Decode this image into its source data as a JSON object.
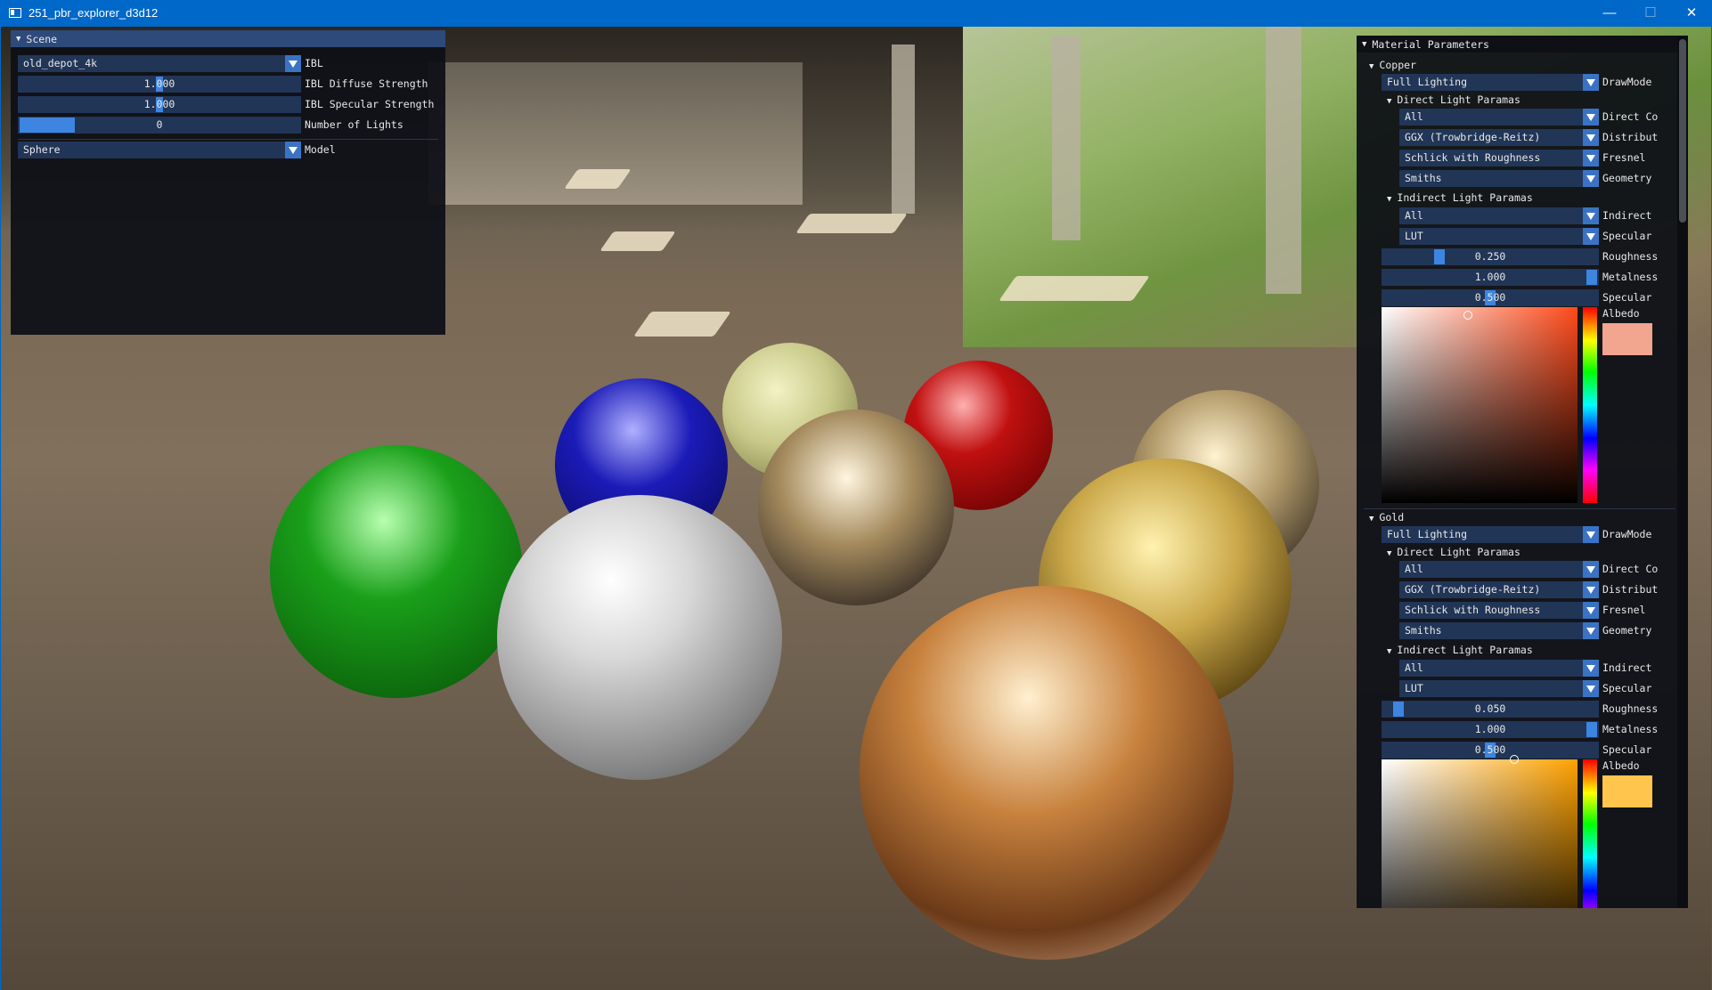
{
  "window": {
    "title": "251_pbr_explorer_d3d12",
    "minimize": "—",
    "maximize": "☐",
    "close": "✕"
  },
  "scene_panel": {
    "title": "Scene",
    "ibl": {
      "value": "old_depot_4k",
      "label": "IBL"
    },
    "diffuse": {
      "value": "1.000",
      "label": "IBL Diffuse Strength",
      "fraction": 0.5
    },
    "specular": {
      "value": "1.000",
      "label": "IBL Specular Strength",
      "fraction": 0.5
    },
    "lights": {
      "value": "0",
      "label": "Number of Lights",
      "fraction": 0.0
    },
    "model": {
      "value": "Sphere",
      "label": "Model"
    }
  },
  "material_panel": {
    "title": "Material Parameters",
    "materials": [
      {
        "name": "Copper",
        "drawmode": {
          "value": "Full Lighting",
          "label": "DrawMode"
        },
        "direct_header": "Direct Light Paramas",
        "direct": [
          {
            "value": "All",
            "label": "Direct Co"
          },
          {
            "value": "GGX (Trowbridge-Reitz)",
            "label": "Distribut"
          },
          {
            "value": "Schlick with Roughness",
            "label": "Fresnel"
          },
          {
            "value": "Smiths",
            "label": "Geometry"
          }
        ],
        "indirect_header": "Indirect Light Paramas",
        "indirect": [
          {
            "value": "All",
            "label": "Indirect"
          },
          {
            "value": "LUT",
            "label": "Specular"
          }
        ],
        "roughness": {
          "value": "0.250",
          "label": "Roughness",
          "fraction": 0.25
        },
        "metalness": {
          "value": "1.000",
          "label": "Metalness",
          "fraction": 1.0
        },
        "specular": {
          "value": "0.500",
          "label": "Specular",
          "fraction": 0.5
        },
        "albedo": {
          "label": "Albedo",
          "color": "#f2a58f",
          "hue_color": "#ff4a1a"
        }
      },
      {
        "name": "Gold",
        "drawmode": {
          "value": "Full Lighting",
          "label": "DrawMode"
        },
        "direct_header": "Direct Light Paramas",
        "direct": [
          {
            "value": "All",
            "label": "Direct Co"
          },
          {
            "value": "GGX (Trowbridge-Reitz)",
            "label": "Distribut"
          },
          {
            "value": "Schlick with Roughness",
            "label": "Fresnel"
          },
          {
            "value": "Smiths",
            "label": "Geometry"
          }
        ],
        "indirect_header": "Indirect Light Paramas",
        "indirect": [
          {
            "value": "All",
            "label": "Indirect"
          },
          {
            "value": "LUT",
            "label": "Specular"
          }
        ],
        "roughness": {
          "value": "0.050",
          "label": "Roughness",
          "fraction": 0.05
        },
        "metalness": {
          "value": "1.000",
          "label": "Metalness",
          "fraction": 1.0
        },
        "specular": {
          "value": "0.500",
          "label": "Specular",
          "fraction": 0.5
        },
        "albedo": {
          "label": "Albedo",
          "color": "#ffc54d",
          "hue_color": "#ffa200"
        }
      }
    ]
  },
  "colors": {
    "titlebar": "#0068c8",
    "panel_bg": "#0e1016",
    "frame_bg": "#213557",
    "accent": "#3d85e0",
    "sphere_green": "#1aa01a",
    "sphere_blue": "#1b1bb8",
    "sphere_red": "#c01010",
    "sphere_khaki": "#c9c98a",
    "sphere_silver": "#d8d8d8",
    "sphere_gold": "#caa84a",
    "sphere_copper": "#d9a080"
  }
}
